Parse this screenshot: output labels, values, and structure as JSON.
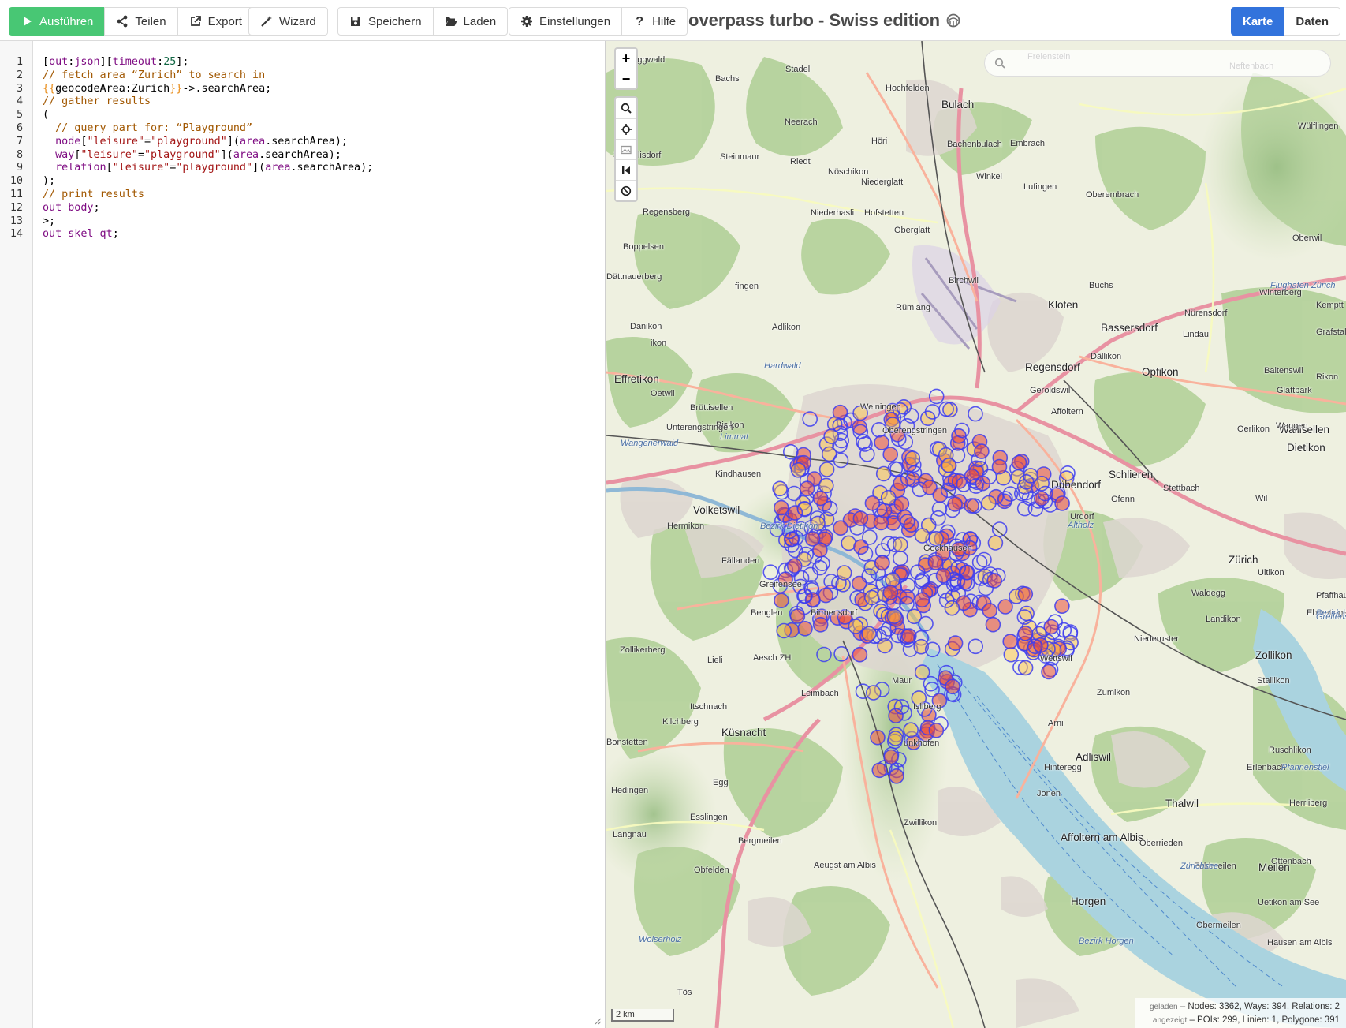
{
  "toolbar": {
    "run_label": "Ausführen",
    "share_label": "Teilen",
    "export_label": "Export",
    "wizard_label": "Wizard",
    "save_label": "Speichern",
    "load_label": "Laden",
    "settings_label": "Einstellungen",
    "help_label": "Hilfe",
    "title": "overpass turbo - Swiss edition",
    "view_map_label": "Karte",
    "view_data_label": "Daten"
  },
  "editor": {
    "lines": [
      {
        "n": "1",
        "parts": [
          [
            "op",
            "["
          ],
          [
            "kw",
            "out"
          ],
          [
            "op",
            ":"
          ],
          [
            "kw",
            "json"
          ],
          [
            "op",
            "]["
          ],
          [
            "kw",
            "timeout"
          ],
          [
            "op",
            ":"
          ],
          [
            "num",
            "25"
          ],
          [
            "op",
            "];"
          ]
        ]
      },
      {
        "n": "2",
        "parts": [
          [
            "cm",
            "// fetch area “Zurich” to search in"
          ]
        ]
      },
      {
        "n": "3",
        "parts": [
          [
            "tpl",
            "{{"
          ],
          [
            "op",
            "geocodeArea:Zurich"
          ],
          [
            "tpl",
            "}}"
          ],
          [
            "op",
            "->.searchArea;"
          ]
        ]
      },
      {
        "n": "4",
        "parts": [
          [
            "cm",
            "// gather results"
          ]
        ]
      },
      {
        "n": "5",
        "parts": [
          [
            "op",
            "("
          ]
        ]
      },
      {
        "n": "6",
        "parts": [
          [
            "cm",
            "  // query part for: “Playground”"
          ]
        ]
      },
      {
        "n": "7",
        "parts": [
          [
            "kw",
            "  node"
          ],
          [
            "op",
            "["
          ],
          [
            "str",
            "\"leisure\""
          ],
          [
            "op",
            "="
          ],
          [
            "str",
            "\"playground\""
          ],
          [
            "op",
            "]("
          ],
          [
            "kw",
            "area"
          ],
          [
            "op",
            ".searchArea);"
          ]
        ]
      },
      {
        "n": "8",
        "parts": [
          [
            "kw",
            "  way"
          ],
          [
            "op",
            "["
          ],
          [
            "str",
            "\"leisure\""
          ],
          [
            "op",
            "="
          ],
          [
            "str",
            "\"playground\""
          ],
          [
            "op",
            "]("
          ],
          [
            "kw",
            "area"
          ],
          [
            "op",
            ".searchArea);"
          ]
        ]
      },
      {
        "n": "9",
        "parts": [
          [
            "kw",
            "  relation"
          ],
          [
            "op",
            "["
          ],
          [
            "str",
            "\"leisure\""
          ],
          [
            "op",
            "="
          ],
          [
            "str",
            "\"playground\""
          ],
          [
            "op",
            "]("
          ],
          [
            "kw",
            "area"
          ],
          [
            "op",
            ".searchArea);"
          ]
        ]
      },
      {
        "n": "10",
        "parts": [
          [
            "op",
            ");"
          ]
        ]
      },
      {
        "n": "11",
        "parts": [
          [
            "cm",
            "// print results"
          ]
        ]
      },
      {
        "n": "12",
        "parts": [
          [
            "kw",
            "out body"
          ],
          [
            "op",
            ";"
          ]
        ]
      },
      {
        "n": "13",
        "parts": [
          [
            "op",
            ">;"
          ]
        ]
      },
      {
        "n": "14",
        "parts": [
          [
            "kw",
            "out skel qt"
          ],
          [
            "op",
            ";"
          ]
        ]
      }
    ]
  },
  "map": {
    "search_placeholder": "",
    "scale_label": "2 km",
    "stats": {
      "loaded_label": "geladen",
      "loaded_text": "– Nodes: 3362, Ways: 394, Relations: 2",
      "shown_label": "angezeigt",
      "shown_text": "– POIs: 299, Linien: 1, Polygone: 391"
    },
    "labels": [
      {
        "text": "Eggwald",
        "cls": ""
      },
      {
        "text": "Stadel",
        "cls": ""
      },
      {
        "text": "Bachs",
        "cls": ""
      },
      {
        "text": "Hochfelden",
        "cls": ""
      },
      {
        "text": "Bulach",
        "cls": "big"
      },
      {
        "text": "Bachenbulach",
        "cls": ""
      },
      {
        "text": "Embrach",
        "cls": ""
      },
      {
        "text": "Freienstein",
        "cls": ""
      },
      {
        "text": "Neftenbach",
        "cls": ""
      },
      {
        "text": "Wülflingen",
        "cls": ""
      },
      {
        "text": "Neerach",
        "cls": ""
      },
      {
        "text": "Höri",
        "cls": ""
      },
      {
        "text": "Schöfflisdorf",
        "cls": ""
      },
      {
        "text": "Steinmaur",
        "cls": ""
      },
      {
        "text": "Riedt",
        "cls": ""
      },
      {
        "text": "Nöschikon",
        "cls": ""
      },
      {
        "text": "Niederglatt",
        "cls": ""
      },
      {
        "text": "Winkel",
        "cls": ""
      },
      {
        "text": "Lufingen",
        "cls": ""
      },
      {
        "text": "Oberembrach",
        "cls": ""
      },
      {
        "text": "Regensberg",
        "cls": ""
      },
      {
        "text": "Niederhasli",
        "cls": ""
      },
      {
        "text": "Hofstetten",
        "cls": ""
      },
      {
        "text": "Oberglatt",
        "cls": ""
      },
      {
        "text": "Boppelsen",
        "cls": ""
      },
      {
        "text": "Oberwil",
        "cls": ""
      },
      {
        "text": "Dättnauerberg",
        "cls": ""
      },
      {
        "text": "fingen",
        "cls": ""
      },
      {
        "text": "Buchs",
        "cls": ""
      },
      {
        "text": "Flughafen Zürich",
        "cls": "water"
      },
      {
        "text": "Birchwil",
        "cls": ""
      },
      {
        "text": "Winterberg",
        "cls": ""
      },
      {
        "text": "Rümlang",
        "cls": ""
      },
      {
        "text": "Kloten",
        "cls": "big"
      },
      {
        "text": "Bassersdorf",
        "cls": "big"
      },
      {
        "text": "Nürensdorf",
        "cls": ""
      },
      {
        "text": "Kemptt",
        "cls": ""
      },
      {
        "text": "Danikon",
        "cls": ""
      },
      {
        "text": "Adlikon",
        "cls": ""
      },
      {
        "text": "Lindau",
        "cls": ""
      },
      {
        "text": "Grafstal",
        "cls": ""
      },
      {
        "text": "ikon",
        "cls": ""
      },
      {
        "text": "Dällikon",
        "cls": ""
      },
      {
        "text": "Hardwald",
        "cls": "water"
      },
      {
        "text": "Regensdorf",
        "cls": "big"
      },
      {
        "text": "Opfikon",
        "cls": "big"
      },
      {
        "text": "Baltenswil",
        "cls": ""
      },
      {
        "text": "Rikon",
        "cls": ""
      },
      {
        "text": "Effretikon",
        "cls": "big"
      },
      {
        "text": "Oetwil",
        "cls": ""
      },
      {
        "text": "Geroldswil",
        "cls": ""
      },
      {
        "text": "Glattpark",
        "cls": ""
      },
      {
        "text": "Brüttisellen",
        "cls": ""
      },
      {
        "text": "Weiningen",
        "cls": ""
      },
      {
        "text": "Affoltern",
        "cls": ""
      },
      {
        "text": "Wallisellen",
        "cls": "big"
      },
      {
        "text": "Bisikon",
        "cls": ""
      },
      {
        "text": "Unterengstringen",
        "cls": ""
      },
      {
        "text": "Limmat",
        "cls": "water"
      },
      {
        "text": "Oberengstringen",
        "cls": ""
      },
      {
        "text": "Oerlikon",
        "cls": ""
      },
      {
        "text": "Wangen",
        "cls": ""
      },
      {
        "text": "Wangenerwald",
        "cls": "water"
      },
      {
        "text": "Dietikon",
        "cls": "big"
      },
      {
        "text": "Kindhausen",
        "cls": ""
      },
      {
        "text": "Schlieren",
        "cls": "big"
      },
      {
        "text": "Dübendorf",
        "cls": "big"
      },
      {
        "text": "Stettbach",
        "cls": ""
      },
      {
        "text": "Gfenn",
        "cls": ""
      },
      {
        "text": "Wil",
        "cls": ""
      },
      {
        "text": "Volketswil",
        "cls": "big"
      },
      {
        "text": "Urdorf",
        "cls": ""
      },
      {
        "text": "Hermikon",
        "cls": ""
      },
      {
        "text": "Bezirk Dietikon",
        "cls": "water"
      },
      {
        "text": "Altholz",
        "cls": "water"
      },
      {
        "text": "Gockhausen",
        "cls": ""
      },
      {
        "text": "Zürich",
        "cls": "big"
      },
      {
        "text": "Fällanden",
        "cls": ""
      },
      {
        "text": "Uitikon",
        "cls": ""
      },
      {
        "text": "Pfaffhausen",
        "cls": ""
      },
      {
        "text": "Greifensee",
        "cls": ""
      },
      {
        "text": "Waldegg",
        "cls": ""
      },
      {
        "text": "Benglen",
        "cls": ""
      },
      {
        "text": "Birmensdorf",
        "cls": ""
      },
      {
        "text": "Landikon",
        "cls": ""
      },
      {
        "text": "Ebmatingen",
        "cls": ""
      },
      {
        "text": "Bezirk Uster",
        "cls": "water"
      },
      {
        "text": "Greifensee",
        "cls": "water"
      },
      {
        "text": "Niederuster",
        "cls": ""
      },
      {
        "text": "Zollikerberg",
        "cls": ""
      },
      {
        "text": "Lieli",
        "cls": ""
      },
      {
        "text": "Aesch ZH",
        "cls": ""
      },
      {
        "text": "Wettswil",
        "cls": ""
      },
      {
        "text": "Zollikon",
        "cls": "big"
      },
      {
        "text": "Maur",
        "cls": ""
      },
      {
        "text": "Leimbach",
        "cls": ""
      },
      {
        "text": "Stallikon",
        "cls": ""
      },
      {
        "text": "Zumikon",
        "cls": ""
      },
      {
        "text": "Itschnach",
        "cls": ""
      },
      {
        "text": "Isliberg",
        "cls": ""
      },
      {
        "text": "Kilchberg",
        "cls": ""
      },
      {
        "text": "Arni",
        "cls": ""
      },
      {
        "text": "Küsnacht",
        "cls": "big"
      },
      {
        "text": "Bonstetten",
        "cls": ""
      },
      {
        "text": "unkhofen",
        "cls": ""
      },
      {
        "text": "Adliswil",
        "cls": "big"
      },
      {
        "text": "Ruschlikon",
        "cls": ""
      },
      {
        "text": "Hinteregg",
        "cls": ""
      },
      {
        "text": "Erlenbach",
        "cls": ""
      },
      {
        "text": "Pfannenstiel",
        "cls": "water"
      },
      {
        "text": "Egg",
        "cls": ""
      },
      {
        "text": "Hedingen",
        "cls": ""
      },
      {
        "text": "Jonen",
        "cls": ""
      },
      {
        "text": "Thalwil",
        "cls": "big"
      },
      {
        "text": "Herrliberg",
        "cls": ""
      },
      {
        "text": "Esslingen",
        "cls": ""
      },
      {
        "text": "Zwillikon",
        "cls": ""
      },
      {
        "text": "Langnau",
        "cls": ""
      },
      {
        "text": "Ottenbach",
        "cls": ""
      },
      {
        "text": "Bergmeilen",
        "cls": ""
      },
      {
        "text": "Affoltern am Albis",
        "cls": "big"
      },
      {
        "text": "Oberrieden",
        "cls": ""
      },
      {
        "text": "Feldmeilen",
        "cls": ""
      },
      {
        "text": "Zürichsee",
        "cls": "water"
      },
      {
        "text": "Meilen",
        "cls": "big"
      },
      {
        "text": "Uetikon am See",
        "cls": ""
      },
      {
        "text": "Aeugst am Albis",
        "cls": ""
      },
      {
        "text": "Obfelden",
        "cls": ""
      },
      {
        "text": "Horgen",
        "cls": "big"
      },
      {
        "text": "Obermeilen",
        "cls": ""
      },
      {
        "text": "Wolserholz",
        "cls": "water"
      },
      {
        "text": "Bezirk Horgen",
        "cls": "water"
      },
      {
        "text": "Hausen am Albis",
        "cls": ""
      },
      {
        "text": "Tös",
        "cls": ""
      }
    ]
  }
}
